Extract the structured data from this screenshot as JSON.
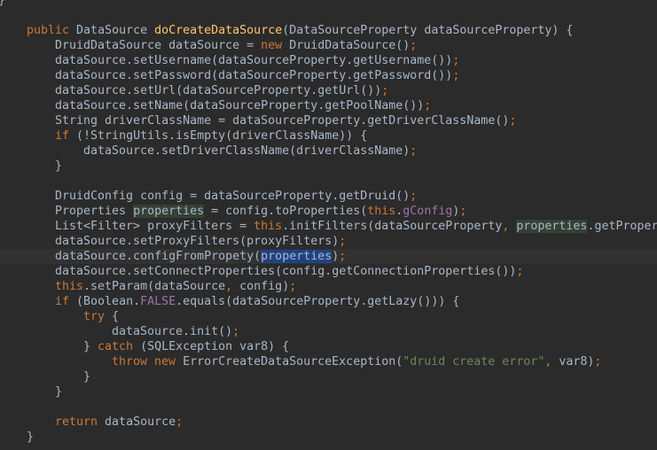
{
  "editor": {
    "lines": [
      {
        "indent": "",
        "segments": [
          {
            "t": "}",
            "c": "var"
          }
        ]
      },
      {
        "indent": "",
        "segments": []
      },
      {
        "indent": "    ",
        "segments": [
          {
            "t": "public ",
            "c": "kw"
          },
          {
            "t": "DataSource ",
            "c": "var"
          },
          {
            "t": "doCreateDataSource",
            "c": "fn"
          },
          {
            "t": "(DataSourceProperty dataSourceProperty) {",
            "c": "var"
          }
        ]
      },
      {
        "indent": "        ",
        "segments": [
          {
            "t": "DruidDataSource dataSource = ",
            "c": "var"
          },
          {
            "t": "new ",
            "c": "kw"
          },
          {
            "t": "DruidDataSource()",
            "c": "var"
          },
          {
            "t": ";",
            "c": "punct"
          }
        ]
      },
      {
        "indent": "        ",
        "segments": [
          {
            "t": "dataSource.setUsername(dataSourceProperty.getUsername())",
            "c": "var"
          },
          {
            "t": ";",
            "c": "punct"
          }
        ]
      },
      {
        "indent": "        ",
        "segments": [
          {
            "t": "dataSource.setPassword(dataSourceProperty.getPassword())",
            "c": "var"
          },
          {
            "t": ";",
            "c": "punct"
          }
        ]
      },
      {
        "indent": "        ",
        "segments": [
          {
            "t": "dataSource.setUrl(dataSourceProperty.getUrl())",
            "c": "var"
          },
          {
            "t": ";",
            "c": "punct"
          }
        ]
      },
      {
        "indent": "        ",
        "segments": [
          {
            "t": "dataSource.setName(dataSourceProperty.getPoolName())",
            "c": "var"
          },
          {
            "t": ";",
            "c": "punct"
          }
        ]
      },
      {
        "indent": "        ",
        "segments": [
          {
            "t": "String driverClassName = dataSourceProperty.getDriverClassName()",
            "c": "var"
          },
          {
            "t": ";",
            "c": "punct"
          }
        ]
      },
      {
        "indent": "        ",
        "segments": [
          {
            "t": "if ",
            "c": "kw"
          },
          {
            "t": "(!StringUtils.",
            "c": "var"
          },
          {
            "t": "isEmpty",
            "c": "var"
          },
          {
            "t": "(driverClassName)) {",
            "c": "var"
          }
        ]
      },
      {
        "indent": "            ",
        "segments": [
          {
            "t": "dataSource.setDriverClassName(driverClassName)",
            "c": "var"
          },
          {
            "t": ";",
            "c": "punct"
          }
        ]
      },
      {
        "indent": "        ",
        "segments": [
          {
            "t": "}",
            "c": "var"
          }
        ]
      },
      {
        "indent": "",
        "segments": []
      },
      {
        "indent": "        ",
        "segments": [
          {
            "t": "DruidConfig config = dataSourceProperty.getDruid()",
            "c": "var"
          },
          {
            "t": ";",
            "c": "punct"
          }
        ]
      },
      {
        "indent": "        ",
        "segments": [
          {
            "t": "Properties ",
            "c": "var"
          },
          {
            "t": "properties",
            "c": "var",
            "h": "hl-read"
          },
          {
            "t": " = config.toProperties(",
            "c": "var"
          },
          {
            "t": "this",
            "c": "kw"
          },
          {
            "t": ".",
            "c": "var"
          },
          {
            "t": "gConfig",
            "c": "field"
          },
          {
            "t": ")",
            "c": "var"
          },
          {
            "t": ";",
            "c": "punct"
          }
        ]
      },
      {
        "indent": "        ",
        "segments": [
          {
            "t": "List<Filter> proxyFilters = ",
            "c": "var"
          },
          {
            "t": "this",
            "c": "kw"
          },
          {
            "t": ".initFilters(dataSourceProperty",
            "c": "var"
          },
          {
            "t": ", ",
            "c": "punct"
          },
          {
            "t": "properties",
            "c": "var",
            "h": "hl-read"
          },
          {
            "t": ".getPropertiesList())",
            "c": "var"
          }
        ]
      },
      {
        "indent": "        ",
        "segments": [
          {
            "t": "dataSource.setProxyFilters(proxyFilters)",
            "c": "var"
          },
          {
            "t": ";",
            "c": "punct"
          }
        ]
      },
      {
        "indent": "        ",
        "caret": true,
        "segments": [
          {
            "t": "dataSource.configFromPropety(",
            "c": "var"
          },
          {
            "t": "properties",
            "c": "var",
            "h": "hl-sel"
          },
          {
            "t": ")",
            "c": "var"
          },
          {
            "t": ";",
            "c": "punct"
          }
        ]
      },
      {
        "indent": "        ",
        "segments": [
          {
            "t": "dataSource.setConnectProperties(config.getConnectionProperties())",
            "c": "var"
          },
          {
            "t": ";",
            "c": "punct"
          }
        ]
      },
      {
        "indent": "        ",
        "segments": [
          {
            "t": "this",
            "c": "kw"
          },
          {
            "t": ".setParam(dataSource",
            "c": "var"
          },
          {
            "t": ", ",
            "c": "punct"
          },
          {
            "t": "config)",
            "c": "var"
          },
          {
            "t": ";",
            "c": "punct"
          }
        ]
      },
      {
        "indent": "        ",
        "segments": [
          {
            "t": "if ",
            "c": "kw"
          },
          {
            "t": "(Boolean.",
            "c": "var"
          },
          {
            "t": "FALSE",
            "c": "field"
          },
          {
            "t": ".equals(dataSourceProperty.getLazy())) {",
            "c": "var"
          }
        ]
      },
      {
        "indent": "            ",
        "segments": [
          {
            "t": "try ",
            "c": "kw"
          },
          {
            "t": "{",
            "c": "var"
          }
        ]
      },
      {
        "indent": "                ",
        "segments": [
          {
            "t": "dataSource.init()",
            "c": "var"
          },
          {
            "t": ";",
            "c": "punct"
          }
        ]
      },
      {
        "indent": "            ",
        "segments": [
          {
            "t": "} ",
            "c": "var"
          },
          {
            "t": "catch ",
            "c": "kw"
          },
          {
            "t": "(SQLException var8) {",
            "c": "var"
          }
        ]
      },
      {
        "indent": "                ",
        "segments": [
          {
            "t": "throw new ",
            "c": "kw"
          },
          {
            "t": "ErrorCreateDataSourceException(",
            "c": "var"
          },
          {
            "t": "\"druid create error\"",
            "c": "str"
          },
          {
            "t": ", ",
            "c": "punct"
          },
          {
            "t": "var8)",
            "c": "var"
          },
          {
            "t": ";",
            "c": "punct"
          }
        ]
      },
      {
        "indent": "            ",
        "segments": [
          {
            "t": "}",
            "c": "var"
          }
        ]
      },
      {
        "indent": "        ",
        "segments": [
          {
            "t": "}",
            "c": "var"
          }
        ]
      },
      {
        "indent": "",
        "segments": []
      },
      {
        "indent": "        ",
        "segments": [
          {
            "t": "return ",
            "c": "kw"
          },
          {
            "t": "dataSource",
            "c": "var"
          },
          {
            "t": ";",
            "c": "punct"
          }
        ]
      },
      {
        "indent": "    ",
        "segments": [
          {
            "t": "}",
            "c": "var"
          }
        ]
      },
      {
        "indent": "",
        "segments": []
      }
    ]
  }
}
